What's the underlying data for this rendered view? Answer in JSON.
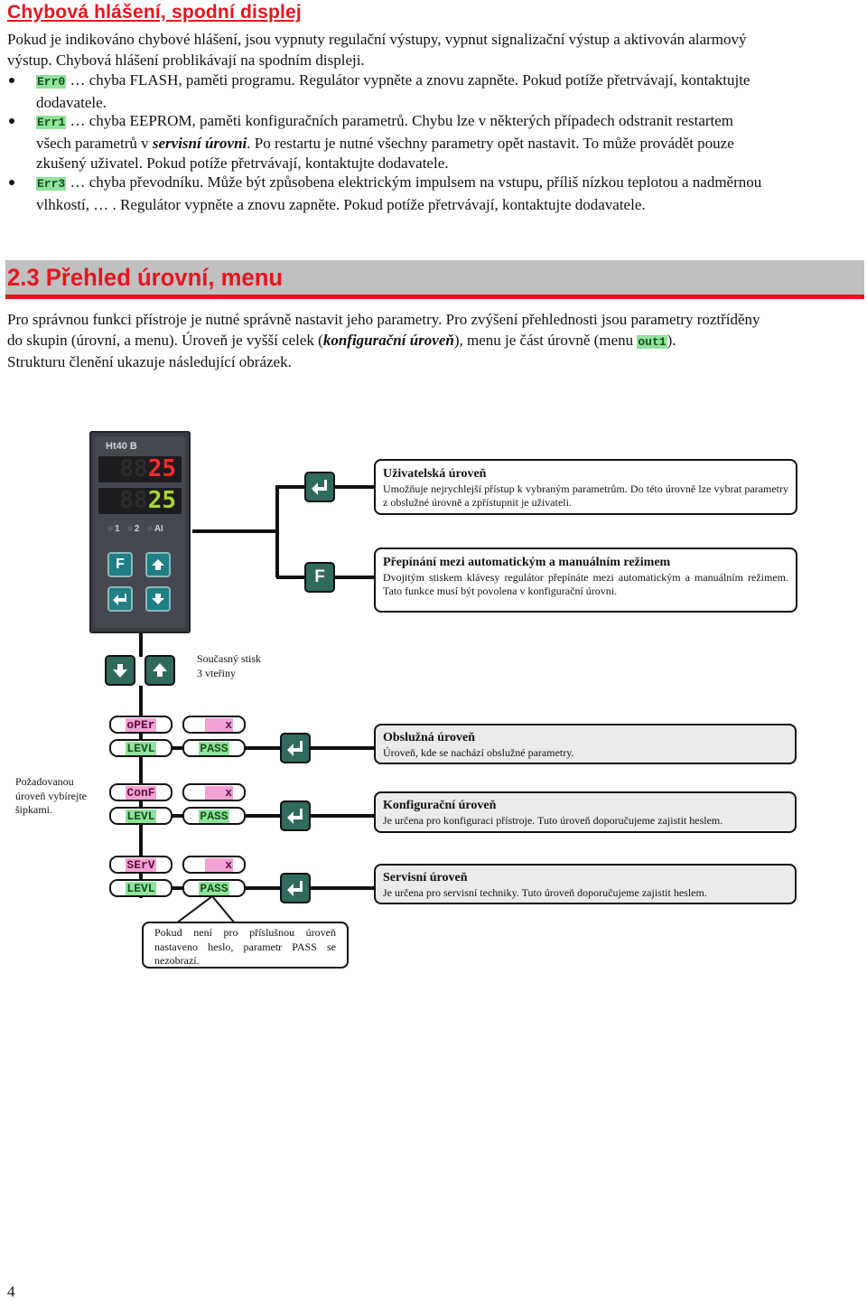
{
  "error_section": {
    "title": "Chybová hlášení, spodní displej",
    "intro_line1": "Pokud je indikováno chybové hlášení, jsou vypnuty regulační výstupy, vypnut signalizační výstup a aktivován alarmový",
    "intro_line2": "výstup. Chybová hlášení problikávají na spodním displeji.",
    "errors": [
      {
        "code": "Err0",
        "line1": "… chyba FLASH, paměti programu. Regulátor vypněte a znovu zapněte. Pokud potíže přetrvávají, kontaktujte",
        "line2": "dodavatele."
      },
      {
        "code": "Err1",
        "line1": "… chyba EEPROM, paměti konfiguračních parametrů. Chybu lze v některých případech odstranit restartem",
        "line2_pre": "všech parametrů v ",
        "line2_em": "servisní úrovni",
        "line2_post": ". Po restartu je nutné všechny parametry opět nastavit. To může provádět pouze",
        "line3": "zkušený uživatel. Pokud potíže přetrvávají, kontaktujte dodavatele."
      },
      {
        "code": "Err3",
        "line1": "… chyba převodníku. Může být způsobena elektrickým impulsem na vstupu, příliš nízkou teplotou a nadměrnou",
        "line2": "vlhkostí, … . Regulátor vypněte a znovu zapněte. Pokud potíže přetrvávají, kontaktujte dodavatele."
      }
    ]
  },
  "overview_section": {
    "title": "2.3 Přehled úrovní, menu",
    "p_line1": "Pro správnou funkci přístroje je nutné správně nastavit jeho parametry. Pro zvýšení přehlednosti jsou parametry roztříděny",
    "p_line2_pre": "do skupin (úrovní, a menu). Úroveň je vyšší celek (",
    "p_line2_em": "konfigurační úroveň",
    "p_line2_mid": "), menu je část úrovně (menu ",
    "p_line2_code": "out1",
    "p_line2_post": ").",
    "p_line3": "Strukturu členění ukazuje následující obrázek."
  },
  "device": {
    "model": "Ht40 B",
    "upper_display": "25",
    "lower_display": "25",
    "upper_color": "#ff2a2a",
    "lower_color": "#a8d832",
    "leds": [
      "1",
      "2",
      "AI"
    ],
    "keys": {
      "f": "F",
      "up": "up-arrow",
      "enter": "enter",
      "down": "down-arrow"
    }
  },
  "diagram": {
    "key_f_label": "F",
    "user_level": {
      "title": "Uživatelská úroveň",
      "text": "Umožňuje nejrychlejší přístup k vybraným parametrům. Do této úrovně lze vybrat parametry z obslužné úrovně a zpřístupnit je uživateli."
    },
    "auto_manual": {
      "title": "Přepínání mezi automatickým a manuálním režimem",
      "text": "Dvojitým stiskem klávesy regulátor přepínáte mezi automatickým a manuálním režimem. Tato funkce musí být povolena v konfigurační úrovni."
    },
    "simultaneous_press": {
      "line1": "Současný   stisk",
      "line2": "3 vteřiny"
    },
    "select_hint": {
      "line1": "Požadovanou",
      "line2": "úroveň vybírejte",
      "line3": "šipkami."
    },
    "levels": [
      {
        "code": "oPEr",
        "levl": "LEVL",
        "x": "x",
        "pass": "PASS",
        "title": "Obslužná úroveň",
        "text": "Úroveň, kde se nachází obslužné parametry."
      },
      {
        "code": "ConF",
        "levl": "LEVL",
        "x": "x",
        "pass": "PASS",
        "title": "Konfigurační úroveň",
        "text": "Je určena pro konfiguraci přístroje. Tuto úroveň doporučujeme zajistit heslem."
      },
      {
        "code": "SErV",
        "levl": "LEVL",
        "x": "x",
        "pass": "PASS",
        "title": "Servisní úroveň",
        "text": "Je určena pro servisní techniky.  Tuto úroveň doporučujeme zajistit heslem."
      }
    ],
    "callout": "Pokud není pro příslušnou úroveň nastaveno heslo, parametr PASS se nezobrazí."
  },
  "page_number": "4"
}
